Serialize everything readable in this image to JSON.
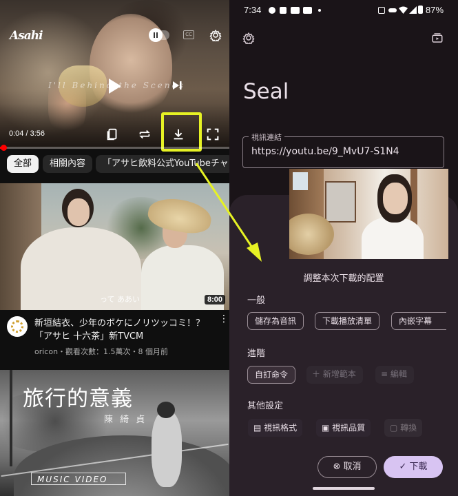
{
  "youtube": {
    "player": {
      "brand_logo_text": "Asahi",
      "watermark_text": "I'll Behind the Scenes",
      "time_label": "0:04 / 3:56",
      "progress_fraction": 0.011,
      "cc_text": "CC"
    },
    "chips": {
      "all": "全部",
      "related": "相關內容",
      "channel": "「アサヒ飲料公式YouTubeチャ"
    },
    "video1": {
      "duration": "8:00",
      "subtitle": "って ああい",
      "title_line1": "新垣結衣、少年のボケにノリツッコミ！？",
      "title_line2": "「アサヒ 十六茶」新TVCM",
      "meta": "oricon・觀看次數：1.5萬次・8 個月前"
    },
    "video2": {
      "title": "旅行的意義",
      "artist": "陳 綺 貞",
      "badge": "MUSIC VIDEO"
    }
  },
  "status_bar": {
    "time": "7:34",
    "battery": "87%"
  },
  "seal": {
    "app_title": "Seal",
    "url_label": "視訊連結",
    "url_value": "https://youtu.be/9_MvU7-S1N4",
    "sheet": {
      "caption": "調整本次下載的配置",
      "general_label": "一般",
      "general_options": [
        "儲存為音訊",
        "下載播放清單",
        "內嵌字幕"
      ],
      "advanced_label": "進階",
      "custom_command": "自訂命令",
      "new_template": "新增範本",
      "edit": "編輯",
      "other_label": "其他設定",
      "video_format": "視訊格式",
      "video_quality": "視訊品質",
      "convert": "轉換",
      "cancel": "取消",
      "download": "下載"
    }
  },
  "colors": {
    "highlight": "#e6f224",
    "accent_button": "#d8c4f2",
    "youtube_red": "#ff0000"
  }
}
